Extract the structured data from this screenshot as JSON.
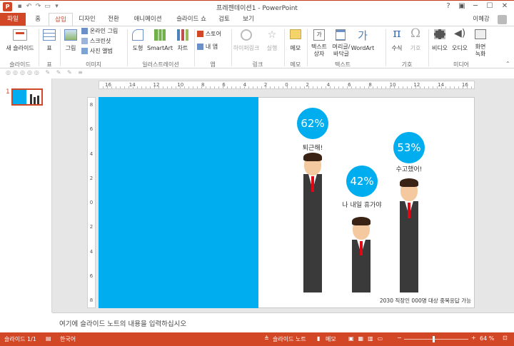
{
  "window": {
    "title": "프레젠테이션1 - PowerPoint",
    "app_icon": "P",
    "user": "이혜강"
  },
  "tabs": [
    "파일",
    "홈",
    "삽입",
    "디자인",
    "전환",
    "애니메이션",
    "슬라이드 쇼",
    "검토",
    "보기"
  ],
  "ribbon": {
    "new_slide": "새 슬라이드",
    "table": "표",
    "picture": "그림",
    "online_picture": "온라인 그림",
    "screenshot": "스크린샷",
    "photo_album": "사진 앨범",
    "shapes": "도형",
    "smartart": "SmartArt",
    "chart": "차트",
    "store": "스토어",
    "my_apps": "내 앱",
    "hyperlink": "하이퍼링크",
    "action": "실행",
    "comment": "메모",
    "textbox_l1": "텍스트",
    "textbox_l2": "상자",
    "header_l1": "머리글/",
    "header_l2": "바닥글",
    "wordart": "WordArt",
    "equation": "수식",
    "symbol": "기호",
    "video": "비디오",
    "audio": "오디오",
    "screen_rec_l1": "화면",
    "screen_rec_l2": "녹화",
    "groups": {
      "slides": "슬라이드",
      "tables": "표",
      "images": "이미지",
      "illustrations": "일러스트레이션",
      "apps": "앱",
      "links": "링크",
      "comments": "메모",
      "text": "텍스트",
      "symbols": "기호",
      "media": "미디어"
    }
  },
  "thumb_number": "1",
  "ruler_labels": [
    "16",
    "14",
    "12",
    "10",
    "8",
    "6",
    "4",
    "2",
    "0",
    "2",
    "4",
    "6",
    "8",
    "10",
    "12",
    "14",
    "16"
  ],
  "vruler_labels": [
    "8",
    "6",
    "4",
    "2",
    "0",
    "2",
    "4",
    "6",
    "8"
  ],
  "slide": {
    "p1": "62%",
    "c1": "퇴근해!",
    "p2": "42%",
    "c2": "나 내일 휴가야",
    "p3": "53%",
    "c3": "수고했어!",
    "footnote": "2030 직장인 000명 대상 중복응답 가능"
  },
  "notes_placeholder": "여기에 슬라이드 노트의 내용을 입력하십시오",
  "status": {
    "slide": "슬라이드 1/1",
    "lang": "한국어",
    "notes": "슬라이드 노트",
    "comments": "메모",
    "zoom": "64 %"
  },
  "colors": {
    "accent": "#d24726",
    "slide_blue": "#00adef"
  }
}
